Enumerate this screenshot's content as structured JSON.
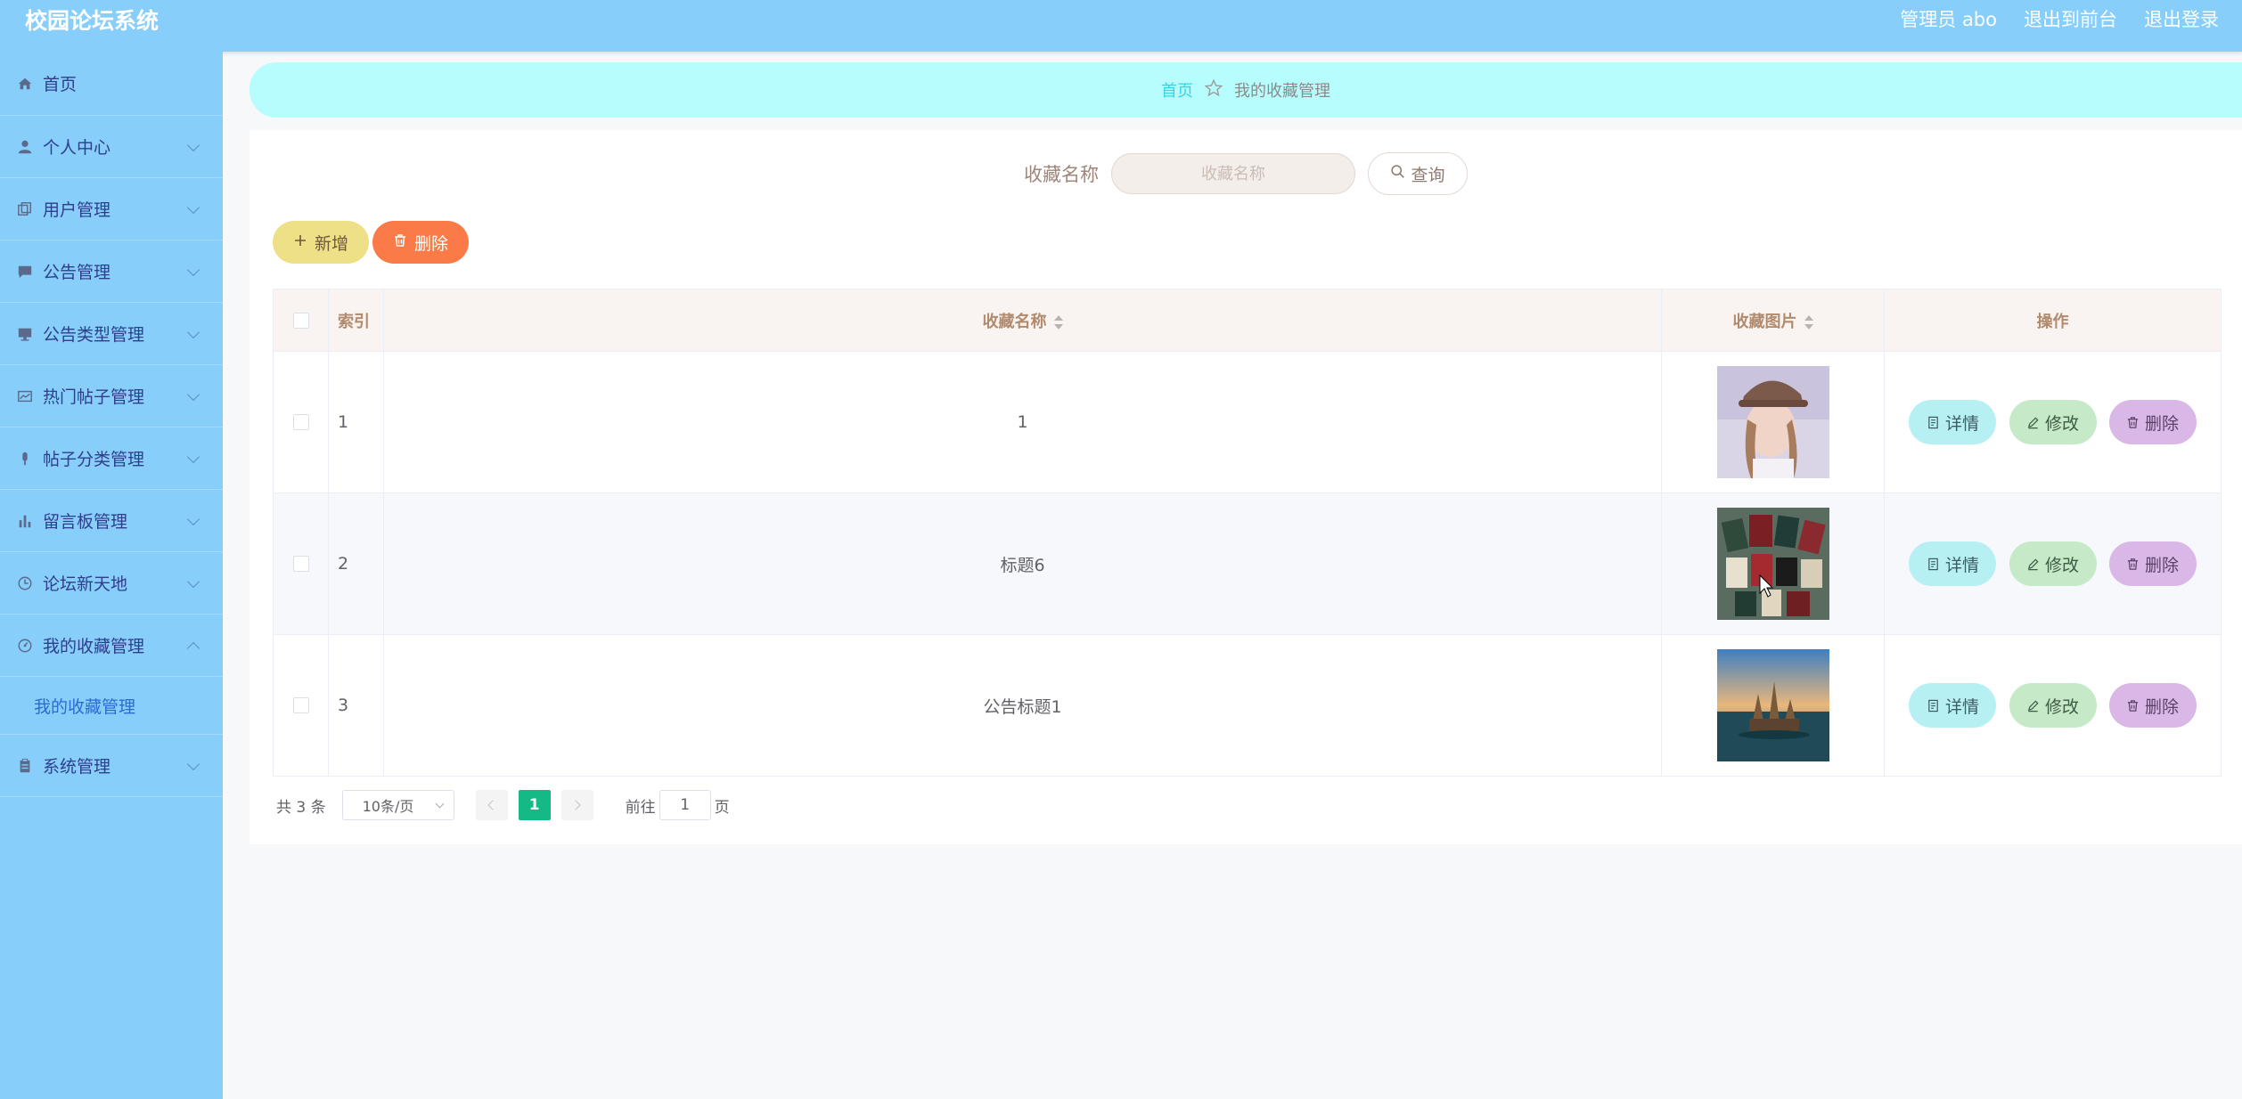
{
  "header": {
    "title": "校园论坛系统",
    "admin": "管理员 abo",
    "to_front": "退出到前台",
    "logout": "退出登录"
  },
  "sidebar": {
    "items": [
      {
        "label": "首页",
        "icon": "home-icon"
      },
      {
        "label": "个人中心",
        "icon": "user-icon"
      },
      {
        "label": "用户管理",
        "icon": "copy-icon"
      },
      {
        "label": "公告管理",
        "icon": "chat-icon"
      },
      {
        "label": "公告类型管理",
        "icon": "monitor-icon"
      },
      {
        "label": "热门帖子管理",
        "icon": "chart-card-icon"
      },
      {
        "label": "帖子分类管理",
        "icon": "microphone-icon"
      },
      {
        "label": "留言板管理",
        "icon": "bar-chart-icon"
      },
      {
        "label": "论坛新天地",
        "icon": "clock-icon"
      },
      {
        "label": "我的收藏管理",
        "icon": "gauge-icon"
      },
      {
        "label": "系统管理",
        "icon": "clipboard-icon"
      }
    ],
    "submenu": "我的收藏管理"
  },
  "breadcrumb": {
    "home": "首页",
    "current": "我的收藏管理"
  },
  "search": {
    "label": "收藏名称",
    "placeholder": "收藏名称",
    "button": "查询"
  },
  "actions": {
    "add": "新增",
    "delete": "删除"
  },
  "table": {
    "columns": {
      "index": "索引",
      "name": "收藏名称",
      "image": "收藏图片",
      "ops": "操作"
    },
    "rows": [
      {
        "index": "1",
        "name": "1",
        "image": "photo-girl-with-cap"
      },
      {
        "index": "2",
        "name": "标题6",
        "image": "photo-books-collection"
      },
      {
        "index": "3",
        "name": "公告标题1",
        "image": "photo-castle-on-lake"
      }
    ],
    "op_labels": {
      "detail": "详情",
      "edit": "修改",
      "delete": "删除"
    }
  },
  "pagination": {
    "total": "共 3 条",
    "page_size": "10条/页",
    "current": "1",
    "goto_prefix": "前往",
    "goto_value": "1",
    "goto_suffix": "页"
  },
  "colors": {
    "header_bg": "#87cefa",
    "sidebar_bg": "#87cefa",
    "breadcrumb_bg": "#b8fdfd",
    "add_btn": "#eee087",
    "delete_btn": "#fa7b48",
    "pager_active": "#14b985"
  }
}
